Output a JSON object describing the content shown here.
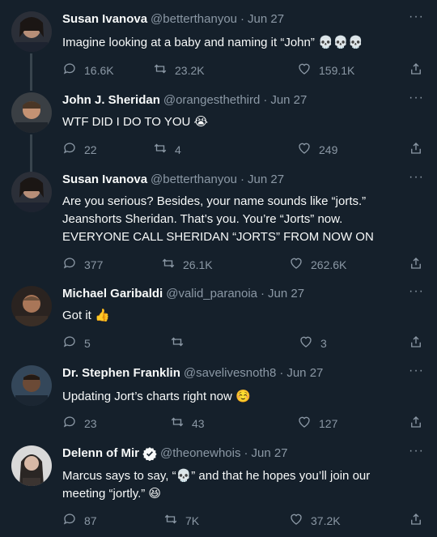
{
  "tweets": [
    {
      "name": "Susan Ivanova",
      "handle": "@betterthanyou",
      "dot": "·",
      "date": "Jun 27",
      "text": "Imagine looking at a baby and naming it “John” 💀💀💀",
      "replies": "16.6K",
      "retweets": "23.2K",
      "likes": "159.1K"
    },
    {
      "name": "John J. Sheridan",
      "handle": "@orangesthethird",
      "dot": "·",
      "date": "Jun 27",
      "text": "WTF DID I DO TO YOU 😭",
      "replies": "22",
      "retweets": "4",
      "likes": "249"
    },
    {
      "name": "Susan Ivanova",
      "handle": "@betterthanyou",
      "dot": "·",
      "date": "Jun 27",
      "text": "Are you serious?  Besides, your name sounds like “jorts.”  Jeanshorts Sheridan.  That’s you.  You’re “Jorts” now.  EVERYONE CALL SHERIDAN “JORTS” FROM NOW ON",
      "replies": "377",
      "retweets": "26.1K",
      "likes": "262.6K"
    },
    {
      "name": "Michael Garibaldi",
      "handle": "@valid_paranoia",
      "dot": "·",
      "date": "Jun 27",
      "text": "Got it 👍",
      "replies": "5",
      "retweets": "",
      "likes": "3"
    },
    {
      "name": "Dr. Stephen Franklin",
      "handle": "@savelivesnoth8",
      "dot": "·",
      "date": "Jun 27",
      "text": "Updating Jort’s charts right now ☺️",
      "replies": "23",
      "retweets": "43",
      "likes": "127"
    },
    {
      "name": "Delenn of Mir",
      "handle": "@theonewhois",
      "dot": "·",
      "date": "Jun 27",
      "text": "Marcus says to say, “💀” and that he hopes you’ll join our meeting “jortly.” 😆",
      "replies": "87",
      "retweets": "7K",
      "likes": "37.2K"
    }
  ],
  "more_glyph": "···",
  "colors": {
    "background": "#15202b",
    "text": "#f7f9f9",
    "secondary": "#8b98a5",
    "verified": "#1d9bf0",
    "thread_line": "#38444d"
  },
  "icons": [
    "reply-icon",
    "retweet-icon",
    "like-icon",
    "share-icon",
    "more-icon",
    "verified-icon"
  ]
}
